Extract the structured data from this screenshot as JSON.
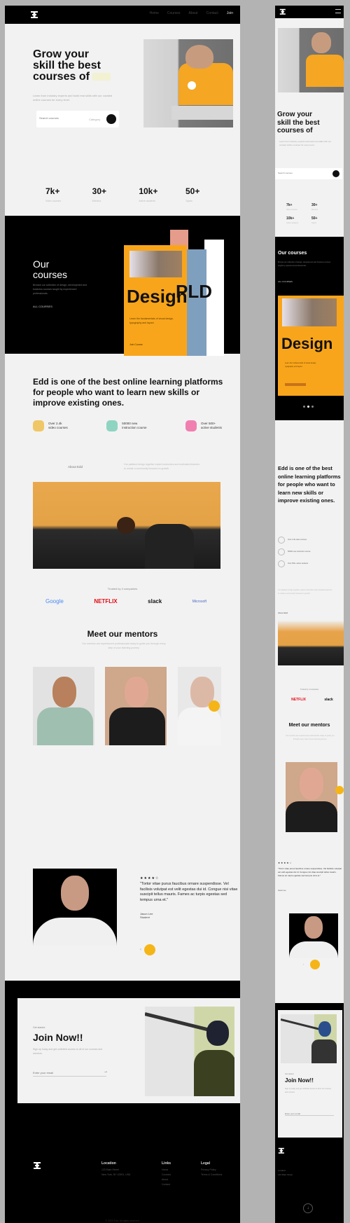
{
  "brand": {
    "logo_icon": "hourglass-logo-icon"
  },
  "nav": {
    "items": [
      "Home",
      "Courses",
      "About",
      "Contact"
    ],
    "cta": "Join"
  },
  "hero": {
    "title_line1": "Grow your",
    "title_line2": "skill the best",
    "title_line3": "courses of",
    "subtitle": "Learn from industry experts and build real skills with our curated online courses for every level.",
    "search_placeholder": "Search courses",
    "search_category": "Category",
    "search_icon": "search-icon",
    "play_icon": "play-icon"
  },
  "stats": [
    {
      "value": "7k+",
      "label": "Video courses"
    },
    {
      "value": "30+",
      "label": "Mentors"
    },
    {
      "value": "10k+",
      "label": "Active students"
    },
    {
      "value": "50+",
      "label": "Topics"
    }
  ],
  "courses": {
    "title_line1": "Our",
    "title_line2": "courses",
    "description": "Browse our collection of design, development and business courses taught by experienced professionals.",
    "link": "ALL COURSES",
    "card_word": "Design",
    "card_text": "Learn the fundamentals of visual design, typography and layout.",
    "card_button": "Join Course",
    "stack_letters": "PLD"
  },
  "about": {
    "title": "Edd is one of the best online learning platforms for people who want to learn new skills or improve existing ones.",
    "features": [
      {
        "line1": "Over 2.4k",
        "line2": "video courses",
        "icon": "video-icon",
        "color": "#f0c766"
      },
      {
        "line1": "50000 new",
        "line2": "instruction course",
        "icon": "book-icon",
        "color": "#8fd4c1"
      },
      {
        "line1": "Over 500+",
        "line2": "active students",
        "icon": "user-icon",
        "color": "#f07fb0"
      }
    ],
    "link": "About Edd",
    "description": "Our platform brings together expert instructors and motivated learners to create a community focused on growth."
  },
  "trusted": {
    "label": "Trusted by 4 companies",
    "logos": [
      "Google",
      "NETFLIX",
      "slack",
      "Microsoft"
    ]
  },
  "mentors": {
    "title": "Meet our mentors",
    "subtitle": "Our mentors are experienced professionals ready to guide you through every step of your learning journey.",
    "next_icon": "arrow-right-icon"
  },
  "testimonial": {
    "stars": "★★★★☆",
    "rating": 4,
    "quote": "\"Tortor vitae purus faucibus ornare suspendisse. Vel facilisis volutpat est velit egestas dui id. Congue nisi vitae suscipit tellus mauris. Fames ac turpis egestas sed tempus urna et.\"",
    "author": "Jason Lee",
    "author_role": "Student",
    "prev_icon": "arrow-left-icon",
    "next_icon": "arrow-right-icon"
  },
  "join": {
    "eyebrow": "Get started",
    "title": "Join Now!!",
    "description": "Sign up today and get unlimited access to all of our courses and mentors.",
    "email_placeholder": "Enter your email",
    "submit_icon": "arrow-right-icon"
  },
  "footer": {
    "location": {
      "heading": "Location",
      "items": [
        "123 Main Street",
        "New York, NY 10001, USA"
      ]
    },
    "links": {
      "heading": "Links",
      "items": [
        "Home",
        "Courses",
        "About",
        "Contact"
      ]
    },
    "legal": {
      "heading": "Legal",
      "items": [
        "Privacy Policy",
        "Terms & Conditions"
      ]
    },
    "copyright": "© 2023 Edd. All rights reserved."
  },
  "mobile": {
    "menu_icon": "hamburger-menu-icon",
    "scroll_top_icon": "arrow-up-icon",
    "carousel_dots": 3,
    "carousel_active": 2
  }
}
